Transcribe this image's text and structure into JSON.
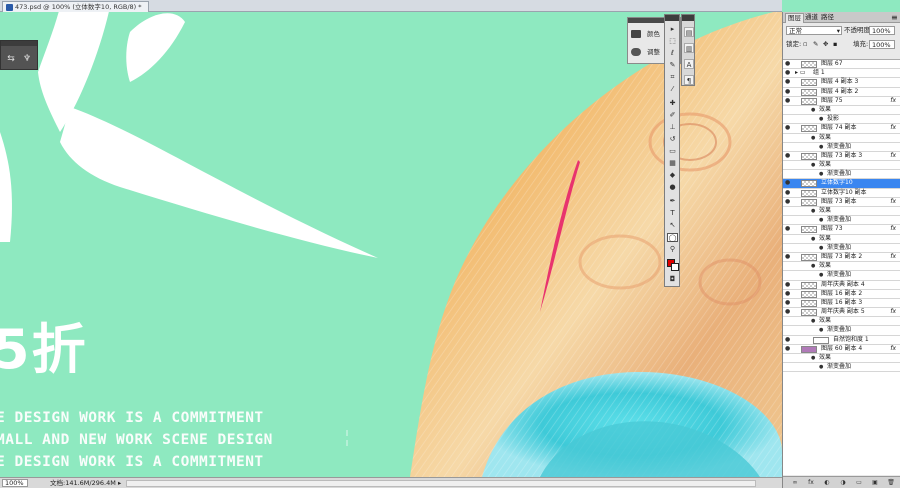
{
  "document": {
    "tab_title": "473.psd @ 100% (立体数字10, RGB/8) *"
  },
  "canvas": {
    "big_text": "5折",
    "english_lines": [
      "E DESIGN WORK IS A COMMITMENT",
      "MALL  AND NEW WORK SCENE DESIGN",
      "E DESIGN WORK IS A COMMITMENT"
    ]
  },
  "adjust_panel": {
    "items": [
      "颜色",
      "调整"
    ]
  },
  "layers_panel": {
    "tabs": [
      "图层",
      "通道",
      "路径"
    ],
    "blend_mode": "正常",
    "opacity_label": "不透明度:",
    "opacity_value": "100%",
    "lock_label": "锁定:",
    "fill_label": "填充:",
    "fill_value": "100%",
    "layers": [
      {
        "name": "图层 67",
        "kind": "layer",
        "fx": ""
      },
      {
        "name": "组 1",
        "kind": "group",
        "fx": ""
      },
      {
        "name": "图层 4 副本 3",
        "kind": "layer",
        "fx": ""
      },
      {
        "name": "图层 4 副本 2",
        "kind": "layer",
        "fx": ""
      },
      {
        "name": "图层 75",
        "kind": "layer",
        "fx": "fx"
      },
      {
        "name": "效果",
        "kind": "effect",
        "fx": ""
      },
      {
        "name": "投影",
        "kind": "effect2",
        "fx": ""
      },
      {
        "name": "图层 74 副本",
        "kind": "layer",
        "fx": "fx"
      },
      {
        "name": "效果",
        "kind": "effect",
        "fx": ""
      },
      {
        "name": "渐变叠加",
        "kind": "effect2",
        "fx": ""
      },
      {
        "name": "图层 73 副本 3",
        "kind": "layer",
        "fx": "fx"
      },
      {
        "name": "效果",
        "kind": "effect",
        "fx": ""
      },
      {
        "name": "渐变叠加",
        "kind": "effect2",
        "fx": ""
      },
      {
        "name": "立体数字10",
        "kind": "selected",
        "fx": ""
      },
      {
        "name": "立体数字10 副本",
        "kind": "layer",
        "fx": ""
      },
      {
        "name": "图层 73 副本",
        "kind": "layer",
        "fx": "fx"
      },
      {
        "name": "效果",
        "kind": "effect",
        "fx": ""
      },
      {
        "name": "渐变叠加",
        "kind": "effect2",
        "fx": ""
      },
      {
        "name": "图层 73",
        "kind": "layer",
        "fx": "fx"
      },
      {
        "name": "效果",
        "kind": "effect",
        "fx": ""
      },
      {
        "name": "渐变叠加",
        "kind": "effect2",
        "fx": ""
      },
      {
        "name": "图层 73 副本 2",
        "kind": "layer",
        "fx": "fx"
      },
      {
        "name": "效果",
        "kind": "effect",
        "fx": ""
      },
      {
        "name": "渐变叠加",
        "kind": "effect2",
        "fx": ""
      },
      {
        "name": "周年庆典 副本 4",
        "kind": "layer",
        "fx": ""
      },
      {
        "name": "图层 16 副本 2",
        "kind": "layer",
        "fx": ""
      },
      {
        "name": "图层 16 副本 3",
        "kind": "layer",
        "fx": ""
      },
      {
        "name": "周年庆典 副本 5",
        "kind": "layer",
        "fx": "fx"
      },
      {
        "name": "效果",
        "kind": "effect",
        "fx": ""
      },
      {
        "name": "渐变叠加",
        "kind": "effect2",
        "fx": ""
      },
      {
        "name": "自然饱和度 1",
        "kind": "adjust",
        "fx": ""
      },
      {
        "name": "图层 60 副本 4",
        "kind": "purple",
        "fx": "fx"
      },
      {
        "name": "效果",
        "kind": "effect",
        "fx": ""
      },
      {
        "name": "渐变叠加",
        "kind": "effect2",
        "fx": ""
      }
    ]
  },
  "status_bar": {
    "zoom": "100%",
    "doc_info": "文档:141.6M/296.4M"
  },
  "colors": {
    "canvas_bg": "#8ee9c0",
    "foreground": "#e10000",
    "selection": "#3a86f0"
  }
}
